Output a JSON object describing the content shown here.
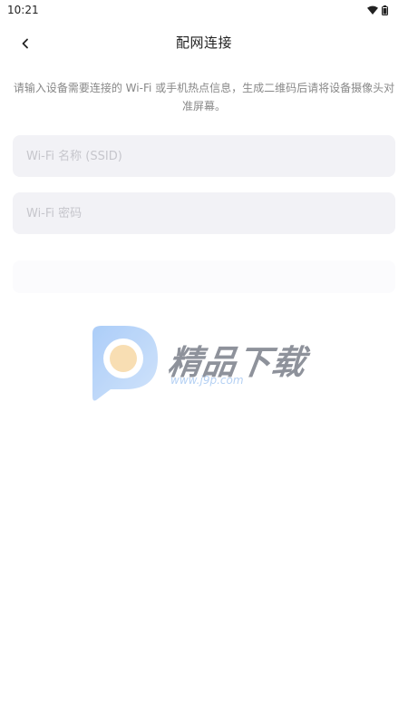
{
  "status_bar": {
    "time": "10:21"
  },
  "header": {
    "title": "配网连接"
  },
  "instructions": "请输入设备需要连接的 Wi-Fi 或手机热点信息，生成二维码后请将设备摄像头对准屏幕。",
  "form": {
    "ssid_placeholder": "Wi-Fi 名称 (SSID)",
    "password_placeholder": "Wi-Fi 密码",
    "ssid_value": "",
    "password_value": ""
  },
  "generate_button": {
    "label": ""
  },
  "watermark": {
    "brand_text": "精品下载",
    "url": "www.j9p.com"
  },
  "colors": {
    "field_bg": "#f2f2f6",
    "text_primary": "#222222",
    "hint": "#888888"
  }
}
